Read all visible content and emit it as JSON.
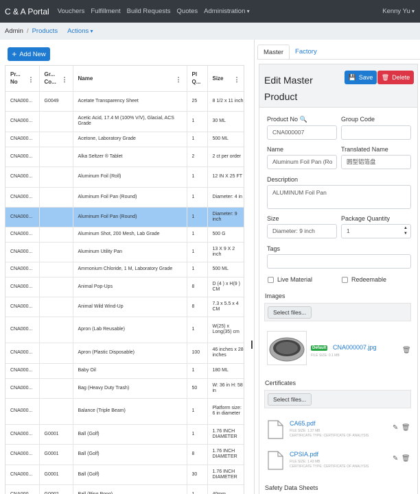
{
  "nav": {
    "brand": "C & A Portal",
    "links": [
      "Vouchers",
      "Fulfillment",
      "Build Requests",
      "Quotes",
      "Administration"
    ],
    "user": "Kenny Yu"
  },
  "breadcrumb": {
    "admin": "Admin",
    "sep": "/",
    "products": "Products",
    "actions": "Actions"
  },
  "add_button": "Add New",
  "table": {
    "headers": [
      [
        "Pr...",
        "No"
      ],
      [
        "Gr...",
        "Co..."
      ],
      [
        "Name"
      ],
      [
        "Pl",
        "Q..."
      ],
      [
        "Size"
      ]
    ],
    "rows": [
      [
        "CNA000...",
        "G0049",
        "Acetate Transparency Sheet",
        "25",
        "8 1/2 x 11 inch"
      ],
      [
        "CNA000...",
        "",
        "Acetic Acid, 17.4 M (100% V/V), Glacial, ACS Grade",
        "1",
        "30 ML"
      ],
      [
        "CNA000...",
        "",
        "Acetone, Laboratory Grade",
        "1",
        "500 ML"
      ],
      [
        "CNA000...",
        "",
        "Alka Seltzer ® Tablet",
        "2",
        "2 ct per order"
      ],
      [
        "CNA000...",
        "",
        "Aluminum Foil (Roll)",
        "1",
        "12 IN X 25 FT"
      ],
      [
        "CNA000...",
        "",
        "Aluminum Foil Pan (Round)",
        "1",
        "Diameter: 4 in"
      ],
      [
        "CNA000...",
        "",
        "Aluminum Foil Pan (Round)",
        "1",
        "Diameter: 9 inch"
      ],
      [
        "CNA000...",
        "",
        "Aluminum Shot, 200 Mesh, Lab Grade",
        "1",
        "500 G"
      ],
      [
        "CNA000...",
        "",
        "Aluminum Utility Pan",
        "1",
        "13 X 9 X 2 inch"
      ],
      [
        "CNA000...",
        "",
        "Ammonium Chloride, 1 M, Laboratory Grade",
        "1",
        "500 ML"
      ],
      [
        "CNA000...",
        "",
        "Animal Pop-Ups",
        "8",
        "D (4 ) x H(9 ) CM"
      ],
      [
        "CNA000...",
        "",
        "Animal Wild Wind-Up",
        "8",
        "7.3 x 5.5 x 4 CM"
      ],
      [
        "CNA000...",
        "",
        "Apron (Lab Reusable)",
        "1",
        "W(25) x Long(35) cm"
      ],
      [
        "CNA000...",
        "",
        "Apron (Plastic Disposable)",
        "100",
        "46 inches x 28 inches"
      ],
      [
        "CNA000...",
        "",
        "Baby Oil",
        "1",
        "180 ML"
      ],
      [
        "CNA000...",
        "",
        "Bag (Heavy Duty Trash)",
        "50",
        "W: 36 in H: 58 in"
      ],
      [
        "CNA000...",
        "",
        "Balance (Triple Beam)",
        "1",
        "Platform size: 6 in diameter"
      ],
      [
        "CNA000...",
        "G0001",
        "Ball (Golf)",
        "1",
        "1.76 INCH DIAMETER"
      ],
      [
        "CNA000...",
        "G0001",
        "Ball (Golf)",
        "8",
        "1.76 INCH DIAMETER"
      ],
      [
        "CNA000...",
        "G0001",
        "Ball (Golf)",
        "30",
        "1.76 INCH DIAMETER"
      ],
      [
        "CNA000...",
        "G0002",
        "Ball (Ping Pong)",
        "1",
        "40mm"
      ]
    ]
  },
  "tabs": {
    "master": "Master",
    "factory": "Factory"
  },
  "form": {
    "title": "Edit Master Product",
    "save": "Save",
    "delete": "Delete",
    "product_no_label": "Product No",
    "product_no": "CNA000007",
    "group_code_label": "Group Code",
    "group_code": "",
    "name_label": "Name",
    "name": "Aluminum Foil Pan (Ro",
    "translated_label": "Translated Name",
    "translated": "圆型铝箔盘",
    "description_label": "Description",
    "description": "ALUMINUM Foil Pan",
    "size_label": "Size",
    "size": "Diameter: 9 inch",
    "package_label": "Package Quantity",
    "package": "1",
    "tags_label": "Tags",
    "live_label": "Live Material",
    "redeemable_label": "Redeemable",
    "images_label": "Images",
    "select_files": "Select files...",
    "certificates_label": "Certificates",
    "safety_label": "Safety Data Sheets"
  },
  "image_file": {
    "badge": "Default",
    "name": "CNA000007.jpg",
    "size": "FILE SIZE: 0.1 MB"
  },
  "certificates": [
    {
      "name": "CA65.pdf",
      "size": "FILE SIZE: 1.37 MB",
      "type": "CERTIFICATE TYPE: CERTIFICATE OF ANALYSIS"
    },
    {
      "name": "CPSIA.pdf",
      "size": "FILE SIZE: 1.43 MB",
      "type": "CERTIFICATE TYPE: CERTIFICATE OF ANALYSIS"
    }
  ],
  "colors": {
    "primary": "#1f7ad1",
    "danger": "#dc3545",
    "success": "#28a745",
    "navbar": "#343a40",
    "selected_row": "#9ccaf5"
  },
  "selected_row_index": 6
}
